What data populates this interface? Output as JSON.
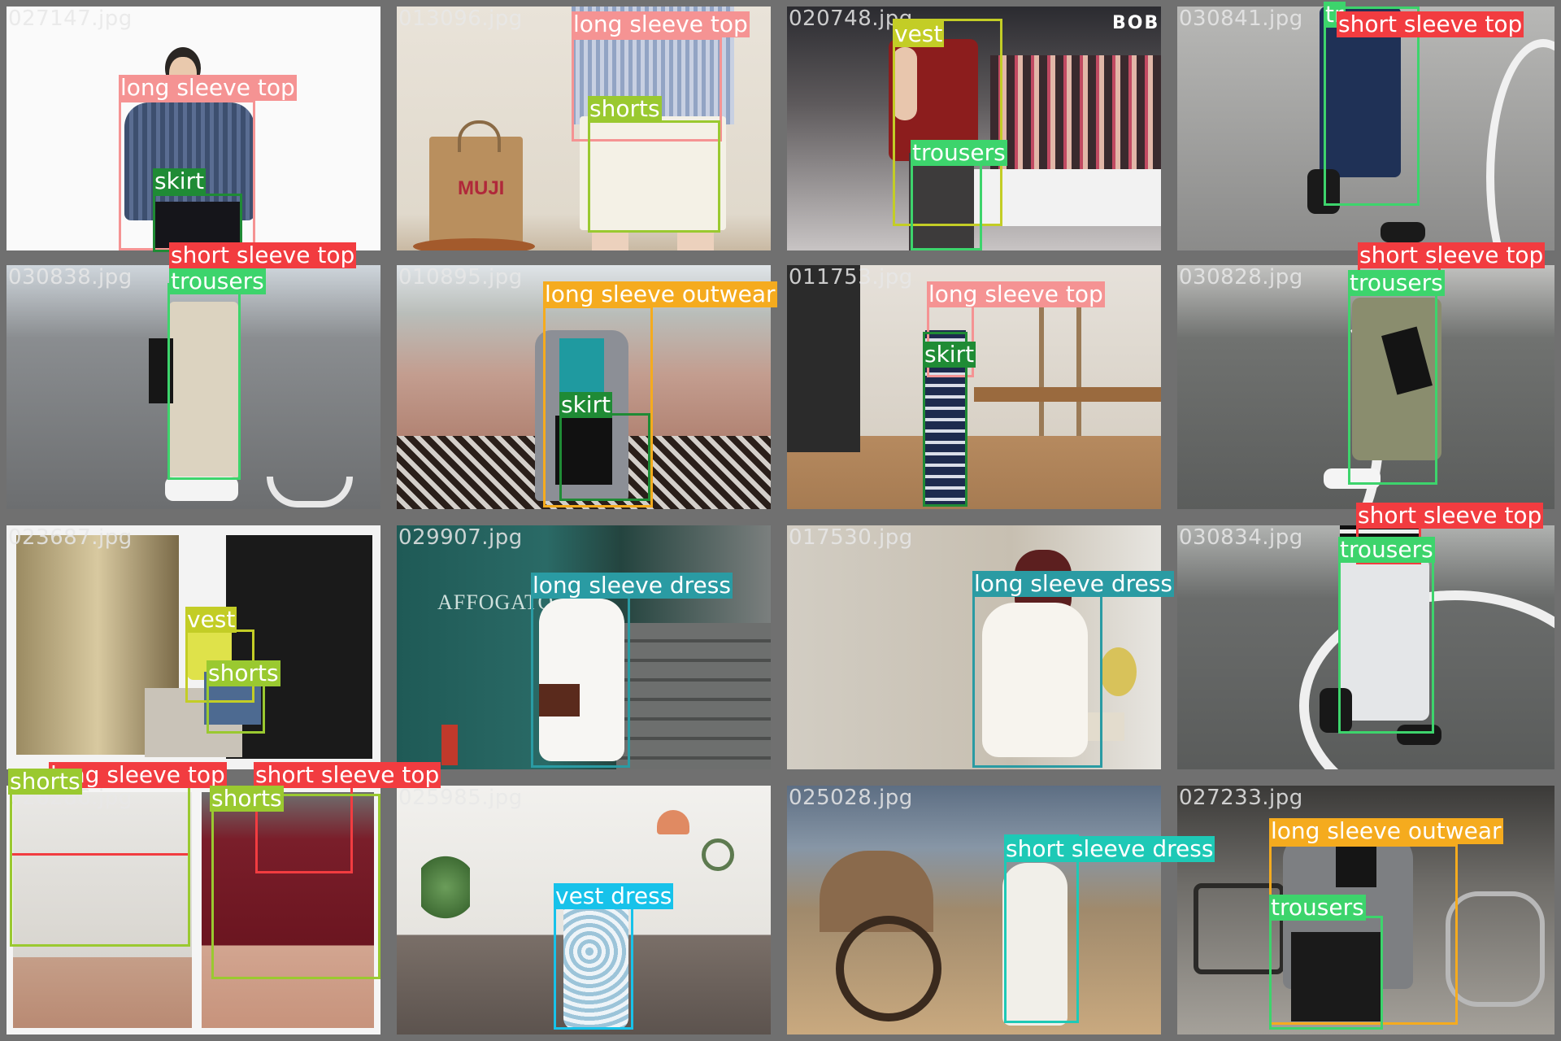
{
  "colors": {
    "long_sleeve_top": "#f59393",
    "short_sleeve_top": "#f23c40",
    "skirt": "#1f8b35",
    "shorts": "#9ac930",
    "trousers": "#3dd46c",
    "vest": "#c3cd26",
    "long_sleeve_outwear": "#f5ab1e",
    "long_sleeve_dress": "#2a9ba3",
    "short_sleeve_dress": "#1ec9b6",
    "vest_dress": "#17c2ea"
  },
  "tiles": [
    {
      "filename": "027147.jpg",
      "labels": [
        "long sleeve top",
        "skirt",
        "short sleeve top",
        "trousers"
      ]
    },
    {
      "filename": "013096.jpg",
      "labels": [
        "long sleeve top",
        "shorts"
      ],
      "bag_text": "MUJI"
    },
    {
      "filename": "020748.jpg",
      "labels": [
        "vest",
        "trousers"
      ],
      "sign_text": "BOBB"
    },
    {
      "filename": "030841.jpg",
      "labels": [
        "short sleeve top",
        "tr"
      ]
    },
    {
      "filename": "030838.jpg",
      "labels": []
    },
    {
      "filename": "010895.jpg",
      "labels": [
        "long sleeve outwear",
        "skirt"
      ]
    },
    {
      "filename": "011753.jpg",
      "labels": [
        "long sleeve top",
        "skirt"
      ]
    },
    {
      "filename": "030828.jpg",
      "labels": [
        "short sleeve top",
        "trousers"
      ]
    },
    {
      "filename": "023687.jpg",
      "labels": [
        "vest",
        "shorts",
        "shorts",
        "long sleeve top",
        "short sleeve top"
      ]
    },
    {
      "filename": "029907.jpg",
      "labels": [
        "long sleeve dress"
      ],
      "wall_text": "AFFOGATO"
    },
    {
      "filename": "017530.jpg",
      "labels": [
        "long sleeve dress"
      ]
    },
    {
      "filename": "030834.jpg",
      "labels": [
        "short sleeve top",
        "trousers"
      ]
    },
    {
      "filename": "026286.jpg",
      "labels": [
        "shorts"
      ]
    },
    {
      "filename": "025985.jpg",
      "labels": [
        "vest dress"
      ]
    },
    {
      "filename": "025028.jpg",
      "labels": [
        "short sleeve dress"
      ]
    },
    {
      "filename": "027233.jpg",
      "labels": [
        "long sleeve outwear",
        "trousers"
      ]
    }
  ]
}
